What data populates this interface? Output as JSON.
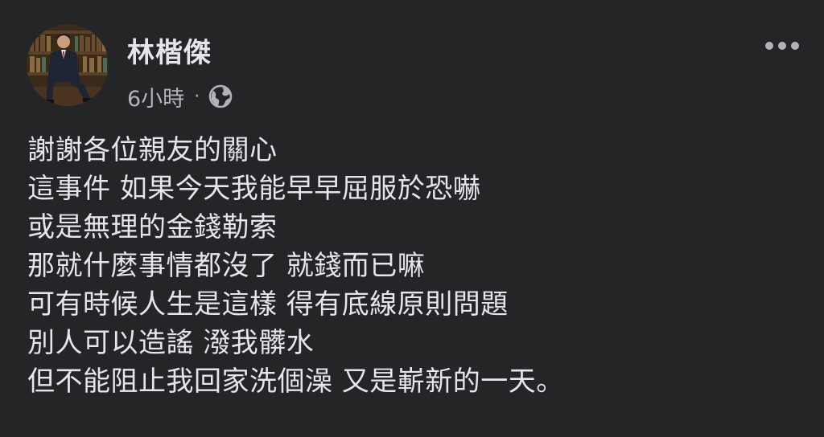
{
  "post": {
    "author_name": "林楷傑",
    "timestamp": "6小時",
    "separator": "·",
    "audience_icon": "globe-icon",
    "more_icon": "more-options-icon",
    "lines": [
      "謝謝各位親友的關心",
      "這事件 如果今天我能早早屈服於恐嚇",
      "或是無理的金錢勒索",
      "那就什麼事情都沒了 就錢而已嘛",
      "可有時候人生是這樣 得有底線原則問題",
      "別人可以造謠 潑我髒水",
      "但不能阻止我回家洗個澡 又是嶄新的一天。"
    ]
  },
  "colors": {
    "background": "#242526",
    "primary_text": "#e4e6eb",
    "secondary_text": "#b0b3b8"
  }
}
